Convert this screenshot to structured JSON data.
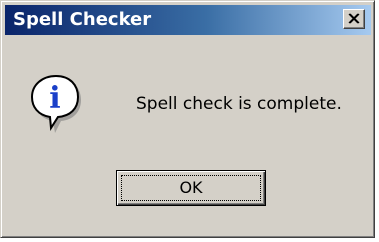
{
  "window": {
    "title": "Spell Checker",
    "close_icon": "close-x-icon"
  },
  "dialog": {
    "icon": "information-icon",
    "icon_letter": "i",
    "message": "Spell check is complete."
  },
  "buttons": {
    "ok_label": "OK"
  },
  "colors": {
    "titlebar_start": "#0a246a",
    "titlebar_end": "#a6caf0",
    "face": "#d4d0c8",
    "icon_blue": "#1a3fc8"
  }
}
